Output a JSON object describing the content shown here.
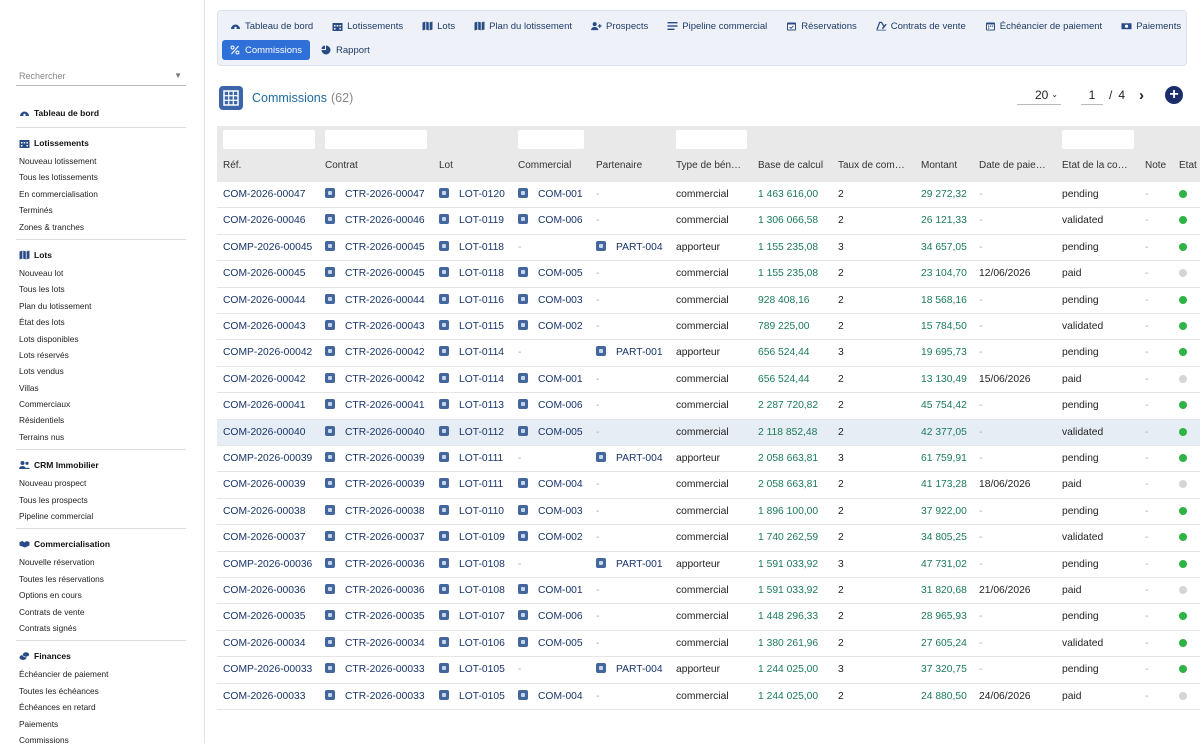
{
  "sidebar": {
    "search_placeholder": "Rechercher",
    "sections": [
      {
        "title": "Tableau de bord",
        "icon": "dashboard-icon",
        "items": []
      },
      {
        "title": "Lotissements",
        "icon": "building-icon",
        "items": [
          "Nouveau lotissement",
          "Tous les lotissements",
          "En commercialisation",
          "Terminés",
          "Zones & tranches"
        ]
      },
      {
        "title": "Lots",
        "icon": "map-icon",
        "items": [
          "Nouveau lot",
          "Tous les lots",
          "Plan du lotissement",
          "État des lots",
          "Lots disponibles",
          "Lots réservés",
          "Lots vendus",
          "Villas",
          "Commerciaux",
          "Résidentiels",
          "Terrains nus"
        ]
      },
      {
        "title": "CRM Immobilier",
        "icon": "users-icon",
        "items": [
          "Nouveau prospect",
          "Tous les prospects",
          "Pipeline commercial"
        ]
      },
      {
        "title": "Commercialisation",
        "icon": "handshake-icon",
        "items": [
          "Nouvelle réservation",
          "Toutes les réservations",
          "Options en cours",
          "Contrats de vente",
          "Contrats signés"
        ]
      },
      {
        "title": "Finances",
        "icon": "coins-icon",
        "items": [
          "Échéancier de paiement",
          "Toutes les échéances",
          "Échéances en retard",
          "Paiements",
          "Commissions"
        ]
      }
    ]
  },
  "nav": {
    "tabs_row1": [
      {
        "label": "Tableau de bord",
        "icon": "dashboard-icon"
      },
      {
        "label": "Lotissements",
        "icon": "building-icon"
      },
      {
        "label": "Lots",
        "icon": "map-icon"
      },
      {
        "label": "Plan du lotissement",
        "icon": "map-icon"
      },
      {
        "label": "Prospects",
        "icon": "user-plus-icon"
      },
      {
        "label": "Pipeline commercial",
        "icon": "list-icon"
      },
      {
        "label": "Réservations",
        "icon": "calendar-check-icon"
      },
      {
        "label": "Contrats de vente",
        "icon": "signature-icon"
      },
      {
        "label": "Échéancier de paiement",
        "icon": "calendar-icon"
      },
      {
        "label": "Paiements",
        "icon": "money-icon"
      }
    ],
    "tabs_row2": [
      {
        "label": "Commissions",
        "icon": "percent-icon",
        "active": true
      },
      {
        "label": "Rapport",
        "icon": "pie-chart-icon"
      }
    ]
  },
  "page": {
    "title": "Commissions",
    "count": "(62)",
    "per_page": "20",
    "current_page": "1",
    "page_separator": "/",
    "total_pages": "4"
  },
  "columns": [
    "Réf.",
    "Contrat",
    "Lot",
    "Commercial",
    "Partenaire",
    "Type de bén…",
    "Base de calcul",
    "Taux de com…",
    "Montant",
    "Date de paie…",
    "État de la co…",
    "Note",
    "État"
  ],
  "rows": [
    {
      "ref": "COM-2026-00047",
      "contrat": "CTR-2026-00047",
      "lot": "LOT-0120",
      "commercial": "COM-001",
      "partenaire": "-",
      "type": "commercial",
      "base": "1 463 616,00",
      "taux": "2",
      "montant": "29 272,32",
      "date": "-",
      "etat": "pending",
      "note": "-",
      "status_color": "#2fb344"
    },
    {
      "ref": "COM-2026-00046",
      "contrat": "CTR-2026-00046",
      "lot": "LOT-0119",
      "commercial": "COM-006",
      "partenaire": "-",
      "type": "commercial",
      "base": "1 306 066,58",
      "taux": "2",
      "montant": "26 121,33",
      "date": "-",
      "etat": "validated",
      "note": "-",
      "status_color": "#2fb344"
    },
    {
      "ref": "COMP-2026-00045",
      "contrat": "CTR-2026-00045",
      "lot": "LOT-0118",
      "commercial": "-",
      "partenaire": "PART-004",
      "type": "apporteur",
      "base": "1 155 235,08",
      "taux": "3",
      "montant": "34 657,05",
      "date": "-",
      "etat": "pending",
      "note": "-",
      "status_color": "#2fb344"
    },
    {
      "ref": "COM-2026-00045",
      "contrat": "CTR-2026-00045",
      "lot": "LOT-0118",
      "commercial": "COM-005",
      "partenaire": "-",
      "type": "commercial",
      "base": "1 155 235,08",
      "taux": "2",
      "montant": "23 104,70",
      "date": "12/06/2026",
      "etat": "paid",
      "note": "-",
      "status_color": "#d5d5d5"
    },
    {
      "ref": "COM-2026-00044",
      "contrat": "CTR-2026-00044",
      "lot": "LOT-0116",
      "commercial": "COM-003",
      "partenaire": "-",
      "type": "commercial",
      "base": "928 408,16",
      "taux": "2",
      "montant": "18 568,16",
      "date": "-",
      "etat": "pending",
      "note": "-",
      "status_color": "#2fb344"
    },
    {
      "ref": "COM-2026-00043",
      "contrat": "CTR-2026-00043",
      "lot": "LOT-0115",
      "commercial": "COM-002",
      "partenaire": "-",
      "type": "commercial",
      "base": "789 225,00",
      "taux": "2",
      "montant": "15 784,50",
      "date": "-",
      "etat": "validated",
      "note": "-",
      "status_color": "#2fb344"
    },
    {
      "ref": "COMP-2026-00042",
      "contrat": "CTR-2026-00042",
      "lot": "LOT-0114",
      "commercial": "-",
      "partenaire": "PART-001",
      "type": "apporteur",
      "base": "656 524,44",
      "taux": "3",
      "montant": "19 695,73",
      "date": "-",
      "etat": "pending",
      "note": "-",
      "status_color": "#2fb344"
    },
    {
      "ref": "COM-2026-00042",
      "contrat": "CTR-2026-00042",
      "lot": "LOT-0114",
      "commercial": "COM-001",
      "partenaire": "-",
      "type": "commercial",
      "base": "656 524,44",
      "taux": "2",
      "montant": "13 130,49",
      "date": "15/06/2026",
      "etat": "paid",
      "note": "-",
      "status_color": "#d5d5d5"
    },
    {
      "ref": "COM-2026-00041",
      "contrat": "CTR-2026-00041",
      "lot": "LOT-0113",
      "commercial": "COM-006",
      "partenaire": "-",
      "type": "commercial",
      "base": "2 287 720,82",
      "taux": "2",
      "montant": "45 754,42",
      "date": "-",
      "etat": "pending",
      "note": "-",
      "status_color": "#2fb344"
    },
    {
      "ref": "COM-2026-00040",
      "contrat": "CTR-2026-00040",
      "lot": "LOT-0112",
      "commercial": "COM-005",
      "partenaire": "-",
      "type": "commercial",
      "base": "2 118 852,48",
      "taux": "2",
      "montant": "42 377,05",
      "date": "-",
      "etat": "validated",
      "note": "-",
      "status_color": "#2fb344",
      "highlight": true
    },
    {
      "ref": "COMP-2026-00039",
      "contrat": "CTR-2026-00039",
      "lot": "LOT-0111",
      "commercial": "-",
      "partenaire": "PART-004",
      "type": "apporteur",
      "base": "2 058 663,81",
      "taux": "3",
      "montant": "61 759,91",
      "date": "-",
      "etat": "pending",
      "note": "-",
      "status_color": "#2fb344"
    },
    {
      "ref": "COM-2026-00039",
      "contrat": "CTR-2026-00039",
      "lot": "LOT-0111",
      "commercial": "COM-004",
      "partenaire": "-",
      "type": "commercial",
      "base": "2 058 663,81",
      "taux": "2",
      "montant": "41 173,28",
      "date": "18/06/2026",
      "etat": "paid",
      "note": "-",
      "status_color": "#d5d5d5"
    },
    {
      "ref": "COM-2026-00038",
      "contrat": "CTR-2026-00038",
      "lot": "LOT-0110",
      "commercial": "COM-003",
      "partenaire": "-",
      "type": "commercial",
      "base": "1 896 100,00",
      "taux": "2",
      "montant": "37 922,00",
      "date": "-",
      "etat": "pending",
      "note": "-",
      "status_color": "#2fb344"
    },
    {
      "ref": "COM-2026-00037",
      "contrat": "CTR-2026-00037",
      "lot": "LOT-0109",
      "commercial": "COM-002",
      "partenaire": "-",
      "type": "commercial",
      "base": "1 740 262,59",
      "taux": "2",
      "montant": "34 805,25",
      "date": "-",
      "etat": "validated",
      "note": "-",
      "status_color": "#2fb344"
    },
    {
      "ref": "COMP-2026-00036",
      "contrat": "CTR-2026-00036",
      "lot": "LOT-0108",
      "commercial": "-",
      "partenaire": "PART-001",
      "type": "apporteur",
      "base": "1 591 033,92",
      "taux": "3",
      "montant": "47 731,02",
      "date": "-",
      "etat": "pending",
      "note": "-",
      "status_color": "#2fb344"
    },
    {
      "ref": "COM-2026-00036",
      "contrat": "CTR-2026-00036",
      "lot": "LOT-0108",
      "commercial": "COM-001",
      "partenaire": "-",
      "type": "commercial",
      "base": "1 591 033,92",
      "taux": "2",
      "montant": "31 820,68",
      "date": "21/06/2026",
      "etat": "paid",
      "note": "-",
      "status_color": "#d5d5d5"
    },
    {
      "ref": "COM-2026-00035",
      "contrat": "CTR-2026-00035",
      "lot": "LOT-0107",
      "commercial": "COM-006",
      "partenaire": "-",
      "type": "commercial",
      "base": "1 448 296,33",
      "taux": "2",
      "montant": "28 965,93",
      "date": "-",
      "etat": "pending",
      "note": "-",
      "status_color": "#2fb344"
    },
    {
      "ref": "COM-2026-00034",
      "contrat": "CTR-2026-00034",
      "lot": "LOT-0106",
      "commercial": "COM-005",
      "partenaire": "-",
      "type": "commercial",
      "base": "1 380 261,96",
      "taux": "2",
      "montant": "27 605,24",
      "date": "-",
      "etat": "validated",
      "note": "-",
      "status_color": "#2fb344"
    },
    {
      "ref": "COMP-2026-00033",
      "contrat": "CTR-2026-00033",
      "lot": "LOT-0105",
      "commercial": "-",
      "partenaire": "PART-004",
      "type": "apporteur",
      "base": "1 244 025,00",
      "taux": "3",
      "montant": "37 320,75",
      "date": "-",
      "etat": "pending",
      "note": "-",
      "status_color": "#2fb344"
    },
    {
      "ref": "COM-2026-00033",
      "contrat": "CTR-2026-00033",
      "lot": "LOT-0105",
      "commercial": "COM-004",
      "partenaire": "-",
      "type": "commercial",
      "base": "1 244 025,00",
      "taux": "2",
      "montant": "24 880,50",
      "date": "24/06/2026",
      "etat": "paid",
      "note": "-",
      "status_color": "#d5d5d5"
    }
  ]
}
